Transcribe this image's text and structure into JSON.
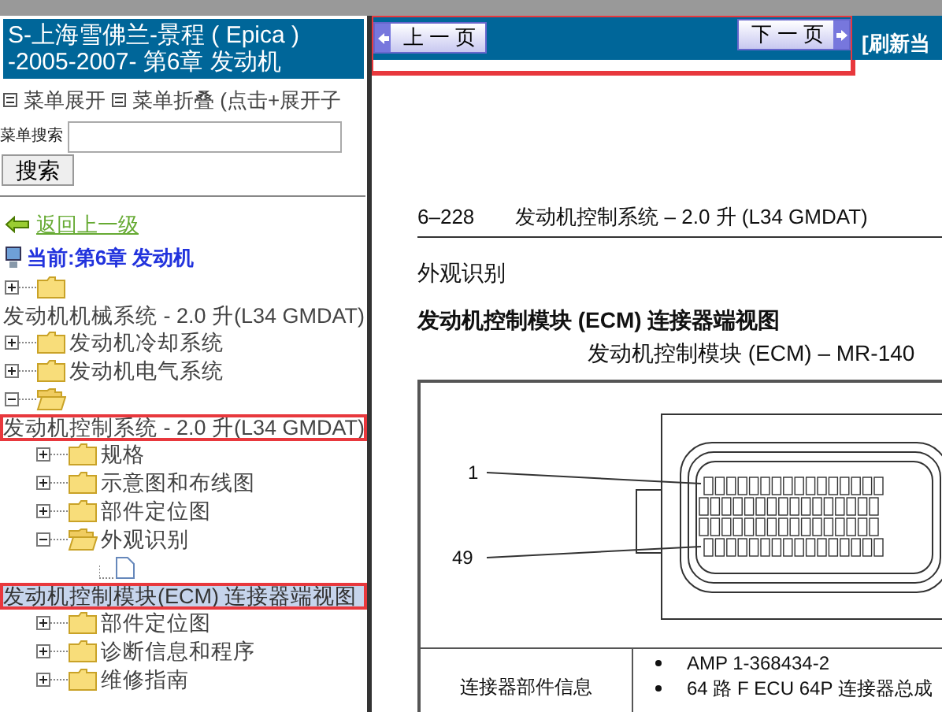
{
  "window_title": "S-上海雪佛兰-景程 ( Epica ) -2005-2007- 第6章 发动机",
  "menu_controls": [
    {
      "label": "菜单展开"
    },
    {
      "label": "菜单折叠 (点击+展开子"
    }
  ],
  "search": {
    "label": "菜单搜索",
    "button": "搜索"
  },
  "back_link": "返回上一级",
  "current": "当前:第6章 发动机",
  "tree": [
    {
      "kind": "folder",
      "label": "发动机机械系统 -  2.0 升(L34 GMDAT)",
      "expanded": false,
      "selected": false,
      "highlighted": false
    },
    {
      "kind": "folder",
      "label": "发动机冷却系统",
      "expanded": false,
      "selected": false,
      "highlighted": false
    },
    {
      "kind": "folder",
      "label": "发动机电气系统",
      "expanded": false,
      "selected": false,
      "highlighted": false
    },
    {
      "kind": "folder",
      "label": "发动机控制系统 -  2.0 升(L34 GMDAT)",
      "expanded": true,
      "selected": false,
      "highlighted": true,
      "children": [
        {
          "kind": "folder",
          "label": "规格",
          "expanded": false,
          "selected": false,
          "highlighted": false
        },
        {
          "kind": "folder",
          "label": "示意图和布线图",
          "expanded": false,
          "selected": false,
          "highlighted": false
        },
        {
          "kind": "folder",
          "label": "部件定位图",
          "expanded": false,
          "selected": false,
          "highlighted": false
        },
        {
          "kind": "folder",
          "label": "外观识别",
          "expanded": true,
          "selected": false,
          "highlighted": false,
          "children": [
            {
              "kind": "page",
              "label": "发动机控制模块(ECM) 连接器端视图",
              "selected": true,
              "highlighted": true
            }
          ]
        },
        {
          "kind": "folder",
          "label": "部件定位图",
          "expanded": false,
          "selected": false,
          "highlighted": false
        },
        {
          "kind": "folder",
          "label": "诊断信息和程序",
          "expanded": false,
          "selected": false,
          "highlighted": false
        },
        {
          "kind": "folder",
          "label": "维修指南",
          "expanded": false,
          "selected": false,
          "highlighted": false
        }
      ]
    }
  ],
  "nav": {
    "prev": "上 一 页",
    "next": "下 一 页",
    "refresh": "[刷新当",
    "highlighted": true
  },
  "document": {
    "page_number": "6–228",
    "running_head": "发动机控制系统 – 2.0 升 (L34 GMDAT)",
    "section": "外观识别",
    "heading": "发动机控制模块 (ECM) 连接器端视图",
    "figure_title": "发动机控制模块 (ECM) – MR-140",
    "pin_labels": [
      "1",
      "49"
    ],
    "info_label": "连接器部件信息",
    "info_items": [
      "AMP 1-368434-2",
      "64 路 F ECU 64P 连接器总成"
    ]
  }
}
